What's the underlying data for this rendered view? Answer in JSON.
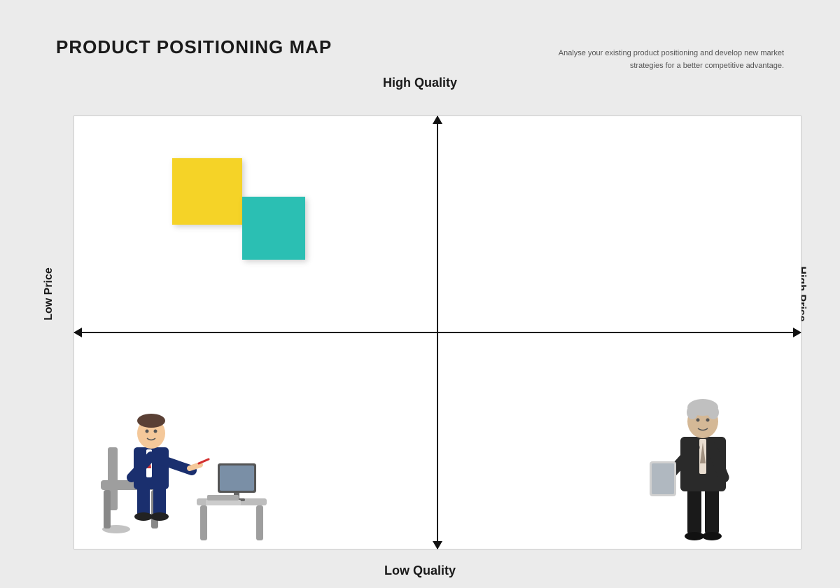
{
  "page": {
    "title": "PRODUCT POSITIONING MAP",
    "subtitle_line1": "Analyse your existing product positioning and develop new market",
    "subtitle_line2": "strategies for a better competitive advantage.",
    "axis": {
      "top": "High Quality",
      "bottom": "Low Quality",
      "left": "Low Price",
      "right": "High Price"
    },
    "chart": {
      "sticky_yellow": {
        "color": "#F5D327"
      },
      "sticky_teal": {
        "color": "#2BBFB3"
      }
    }
  }
}
